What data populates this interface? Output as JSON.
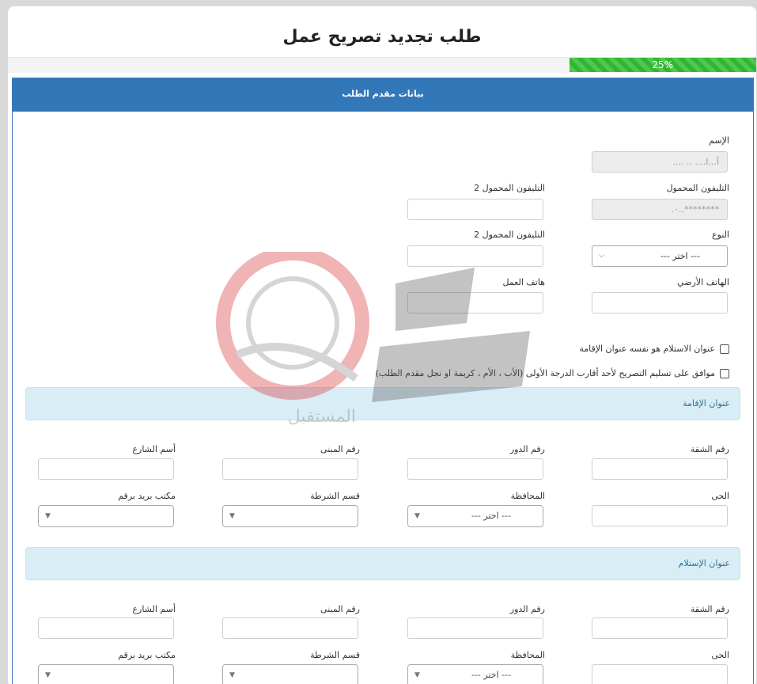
{
  "page": {
    "title": "طلب تجديد تصريح عمل"
  },
  "progress": {
    "value_percent": 25,
    "label": "25%",
    "color": "#2eb82e"
  },
  "panel": {
    "heading": "بيانات مقدم الطلب",
    "header_color": "#3278b8"
  },
  "applicant": {
    "name_label": "الإسم",
    "name_value": "أ...ا.... .. ....",
    "mobile_label": "التليفون المحمول",
    "mobile_value": "********..٠.",
    "mobile2_label": "التليفون المحمول 2",
    "mobile2b_label": "التليفون المحمول 2",
    "gender_label": "النوع",
    "gender_value": "--- اختر ---",
    "landline_label": "الهاتف الأرضي",
    "work_phone_label": "هاتف العمل"
  },
  "checkboxes": {
    "same_address": "عنوان الاستلام هو نفسه عنوان الإقامة",
    "consent": "موافق على تسليم التصريح لأحد أقارب الدرجة الأولى (الأب ، الأم ، كريمة او نجل مقدم الطلب)"
  },
  "residence": {
    "heading": "عنوان الإقامة",
    "apartment_label": "رقم الشقة",
    "floor_label": "رقم الدور",
    "building_label": "رقم المبنى",
    "street_label": "أسم الشارع",
    "district_label": "الحى",
    "governorate_label": "المحافظة",
    "governorate_value": "--- اختر ---",
    "police_label": "قسم الشرطة",
    "postal_label": "مكتب بريد برقم"
  },
  "delivery": {
    "heading": "عنوان الإستلام",
    "apartment_label": "رقم الشقة",
    "floor_label": "رقم الدور",
    "building_label": "رقم المبنى",
    "street_label": "أسم الشارع",
    "district_label": "الحى",
    "governorate_label": "المحافظة",
    "governorate_value": "--- اختر ---",
    "police_label": "قسم الشرطة",
    "postal_label": "مكتب بريد برقم"
  },
  "watermark": {
    "text": "المستقبل",
    "icon": "watermark-logo-icon"
  }
}
